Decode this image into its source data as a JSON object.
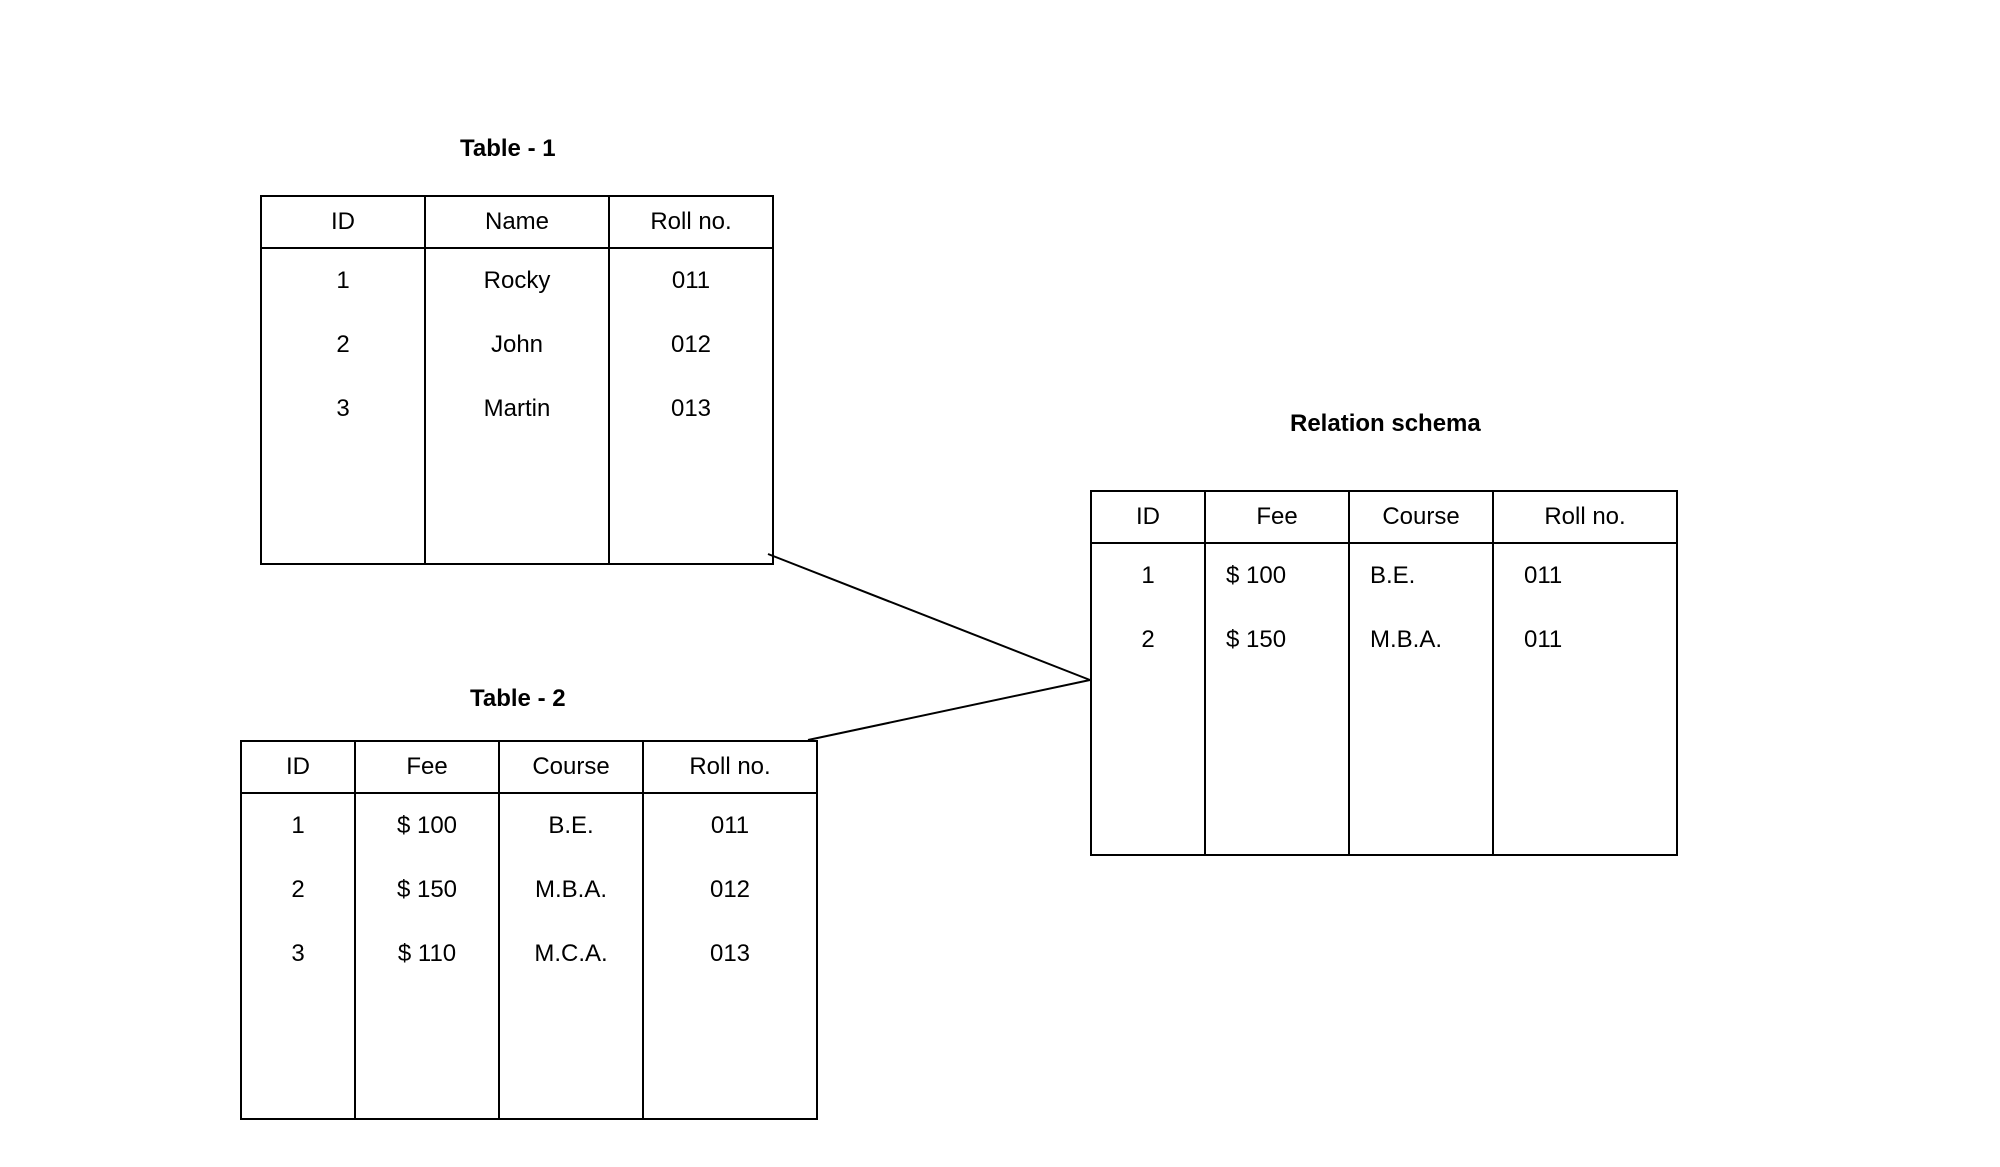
{
  "table1": {
    "title": "Table - 1",
    "headers": [
      "ID",
      "Name",
      "Roll no."
    ],
    "rows": [
      [
        "1",
        "Rocky",
        "011"
      ],
      [
        "2",
        "John",
        "012"
      ],
      [
        "3",
        "Martin",
        "013"
      ]
    ]
  },
  "table2": {
    "title": "Table - 2",
    "headers": [
      "ID",
      "Fee",
      "Course",
      "Roll no."
    ],
    "rows": [
      [
        "1",
        "$ 100",
        "B.E.",
        "011"
      ],
      [
        "2",
        "$ 150",
        "M.B.A.",
        "012"
      ],
      [
        "3",
        "$ 110",
        "M.C.A.",
        "013"
      ]
    ]
  },
  "relation": {
    "title": "Relation schema",
    "headers": [
      "ID",
      "Fee",
      "Course",
      "Roll no."
    ],
    "rows": [
      [
        "1",
        "$ 100",
        "B.E.",
        "011"
      ],
      [
        "2",
        "$ 150",
        "M.B.A.",
        "011"
      ]
    ]
  },
  "chart_data": {
    "type": "table",
    "tables": [
      {
        "name": "Table - 1",
        "columns": [
          "ID",
          "Name",
          "Roll no."
        ],
        "data": [
          {
            "ID": 1,
            "Name": "Rocky",
            "Roll no.": "011"
          },
          {
            "ID": 2,
            "Name": "John",
            "Roll no.": "012"
          },
          {
            "ID": 3,
            "Name": "Martin",
            "Roll no.": "013"
          }
        ]
      },
      {
        "name": "Table - 2",
        "columns": [
          "ID",
          "Fee",
          "Course",
          "Roll no."
        ],
        "data": [
          {
            "ID": 1,
            "Fee": "$ 100",
            "Course": "B.E.",
            "Roll no.": "011"
          },
          {
            "ID": 2,
            "Fee": "$ 150",
            "Course": "M.B.A.",
            "Roll no.": "012"
          },
          {
            "ID": 3,
            "Fee": "$ 110",
            "Course": "M.C.A.",
            "Roll no.": "013"
          }
        ]
      },
      {
        "name": "Relation schema",
        "columns": [
          "ID",
          "Fee",
          "Course",
          "Roll no."
        ],
        "data": [
          {
            "ID": 1,
            "Fee": "$ 100",
            "Course": "B.E.",
            "Roll no.": "011"
          },
          {
            "ID": 2,
            "Fee": "$ 150",
            "Course": "M.B.A.",
            "Roll no.": "011"
          }
        ]
      }
    ],
    "relationships": [
      {
        "from": "Table - 1",
        "to": "Relation schema"
      },
      {
        "from": "Table - 2",
        "to": "Relation schema"
      }
    ]
  }
}
